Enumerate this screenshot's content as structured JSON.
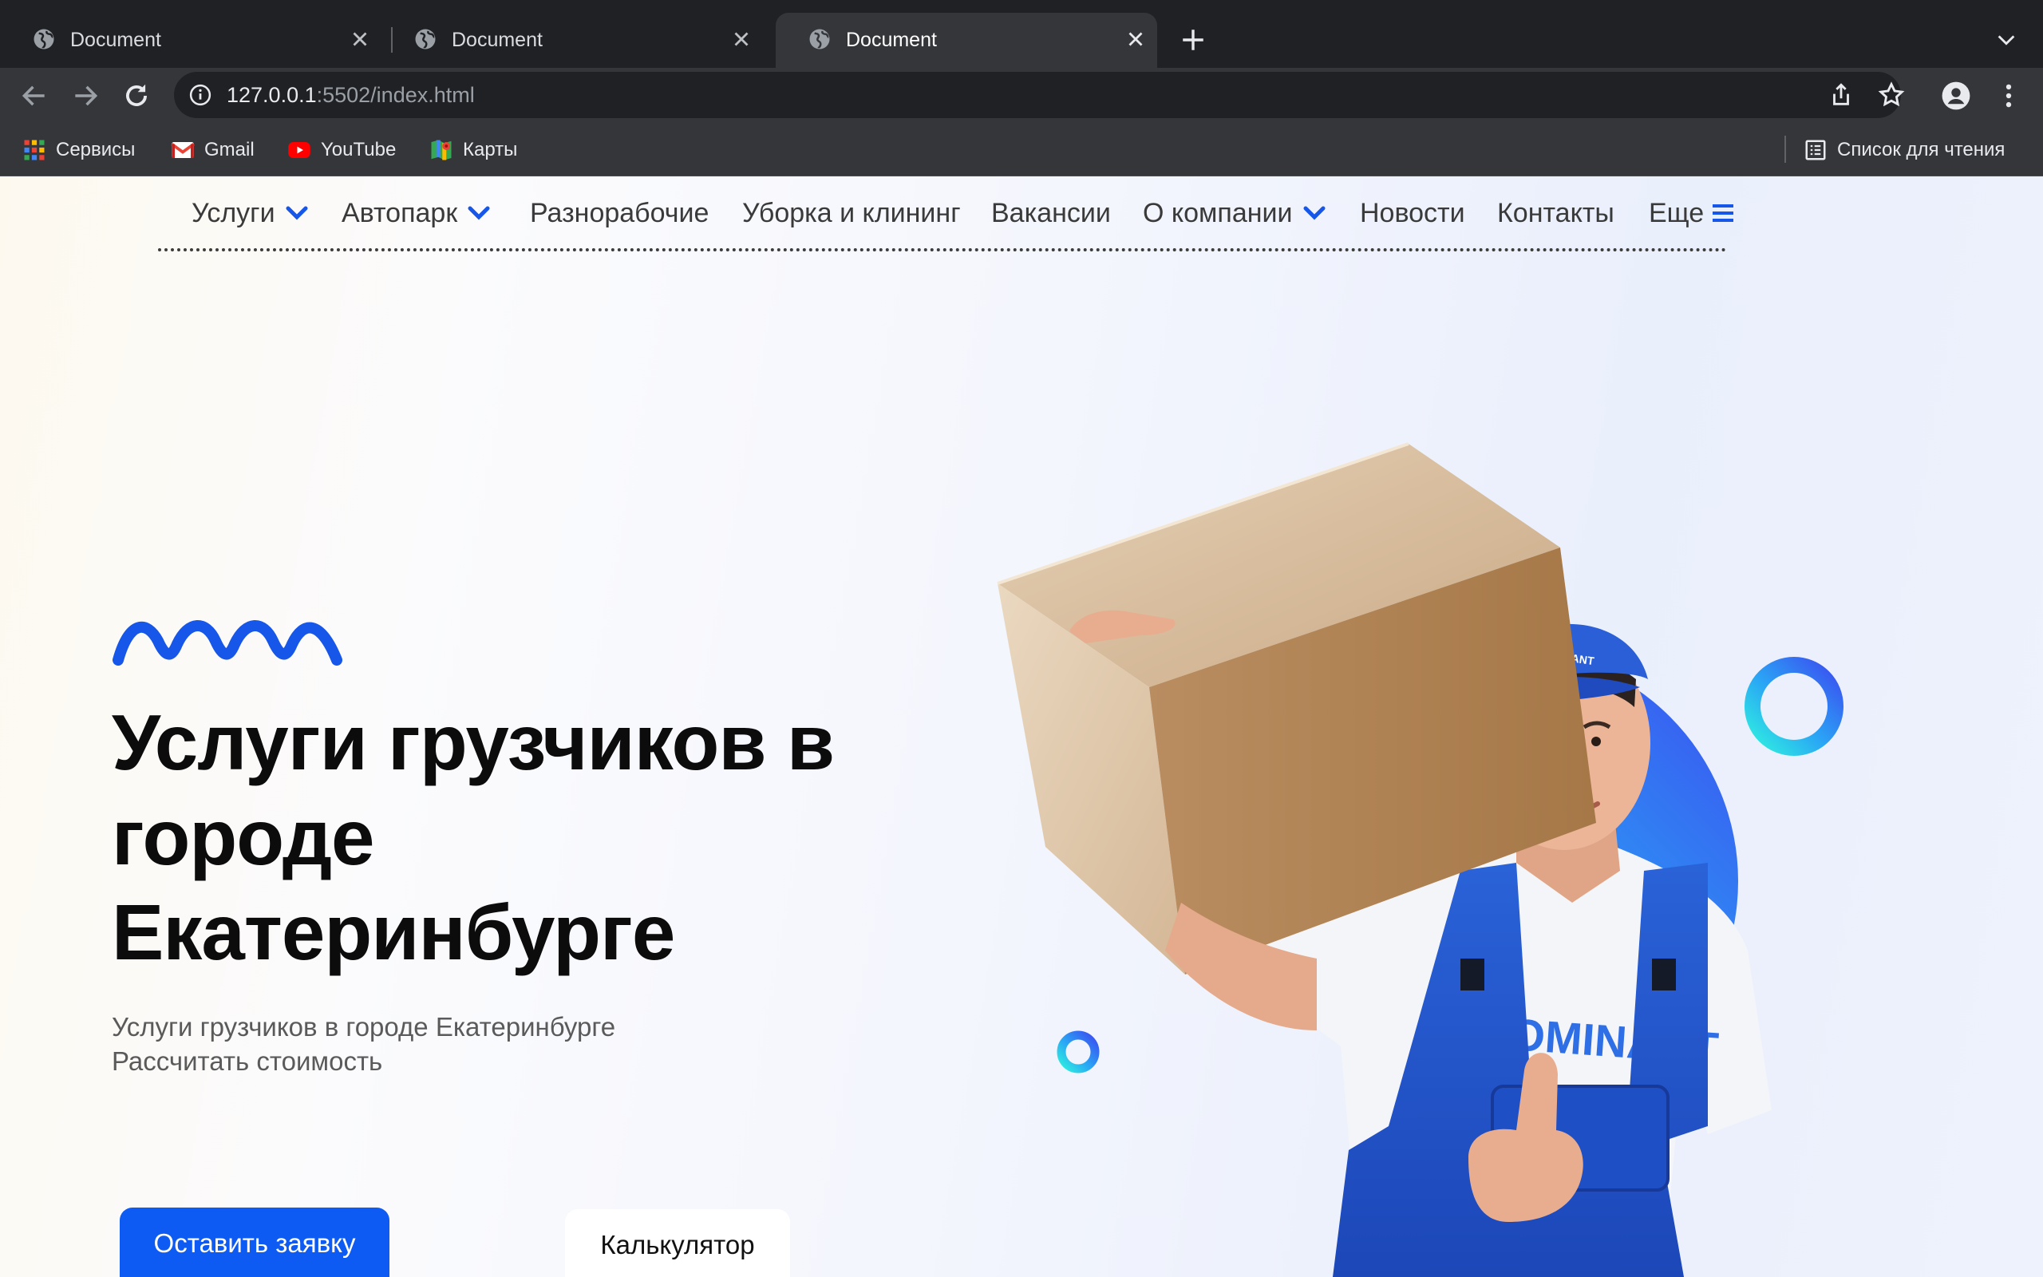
{
  "browser": {
    "tabs": [
      {
        "title": "Document",
        "active": false
      },
      {
        "title": "Document",
        "active": false
      },
      {
        "title": "Document",
        "active": true
      }
    ],
    "address": {
      "host": "127.0.0.1",
      "rest": ":5502/index.html"
    },
    "bookmarks": [
      {
        "label": "Сервисы",
        "icon": "apps-grid-icon"
      },
      {
        "label": "Gmail",
        "icon": "gmail-icon"
      },
      {
        "label": "YouTube",
        "icon": "youtube-icon"
      },
      {
        "label": "Карты",
        "icon": "maps-icon"
      }
    ],
    "reading_list": "Список для чтения"
  },
  "nav": {
    "items": [
      {
        "label": "Услуги",
        "dropdown": true
      },
      {
        "label": "Автопарк",
        "dropdown": true
      },
      {
        "label": "Разнорабочие",
        "dropdown": false
      },
      {
        "label": "Уборка и клининг",
        "dropdown": false
      },
      {
        "label": "Вакансии",
        "dropdown": false
      },
      {
        "label": "О компании",
        "dropdown": true
      },
      {
        "label": "Новости",
        "dropdown": false
      },
      {
        "label": "Контакты",
        "dropdown": false
      },
      {
        "label": "Еще",
        "menu": true
      }
    ]
  },
  "hero": {
    "title_lines": [
      "Услуги грузчиков в",
      "городе",
      "Екатеринбурге"
    ],
    "subtitle_lines": [
      "Услуги грузчиков в городе Екатеринбурге",
      "Рассчитать стоимость"
    ],
    "primary_button": "Оставить заявку",
    "secondary_button": "Калькулятор",
    "cap_logo": "DOMINANT",
    "shirt_logo": "DOMINANT"
  },
  "colors": {
    "accent": "#0d5bf2",
    "chrome_dark": "#202124",
    "chrome_toolbar": "#35363a"
  }
}
